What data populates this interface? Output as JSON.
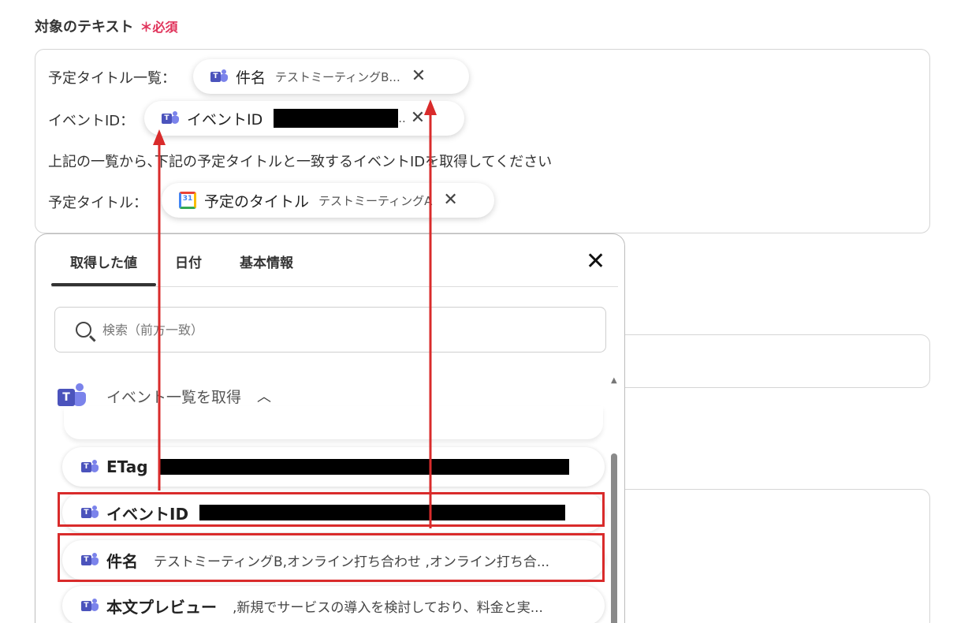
{
  "field": {
    "label": "対象のテキスト",
    "required_mark": "＊必須"
  },
  "editor": {
    "line1_label": "予定タイトル一覧：",
    "line1_pill": {
      "name": "件名",
      "value": "テストミーティングB..."
    },
    "line2_label": "イベントID：",
    "line2_pill": {
      "name": "イベントID",
      "value": ".."
    },
    "line3_text": "上記の一覧から､下記の予定タイトルと一致するイベントIDを取得してください",
    "line4_label": "予定タイトル：",
    "line4_pill": {
      "name": "予定のタイトル",
      "value": "テストミーティングA",
      "calendar_day": "31"
    }
  },
  "panel": {
    "tabs": [
      "取得した値",
      "日付",
      "基本情報"
    ],
    "search_placeholder": "検索（前方一致）",
    "group_title": "イベント一覧を取得",
    "items": [
      {
        "name": "ETag",
        "value": ""
      },
      {
        "name": "イベントID",
        "value": ""
      },
      {
        "name": "件名",
        "value": "テストミーティングB,オンライン打ち合わせ ,オンライン打ち合..."
      },
      {
        "name": "本文プレビュー",
        "value": ",新規でサービスの導入を検討しており、料金と実..."
      }
    ]
  },
  "icons": {
    "teams_letter": "T",
    "close": "✕",
    "chevron_up": "︿"
  },
  "colors": {
    "required": "#e0325a",
    "highlight": "#d92b2b",
    "teams": "#4b53bc"
  }
}
